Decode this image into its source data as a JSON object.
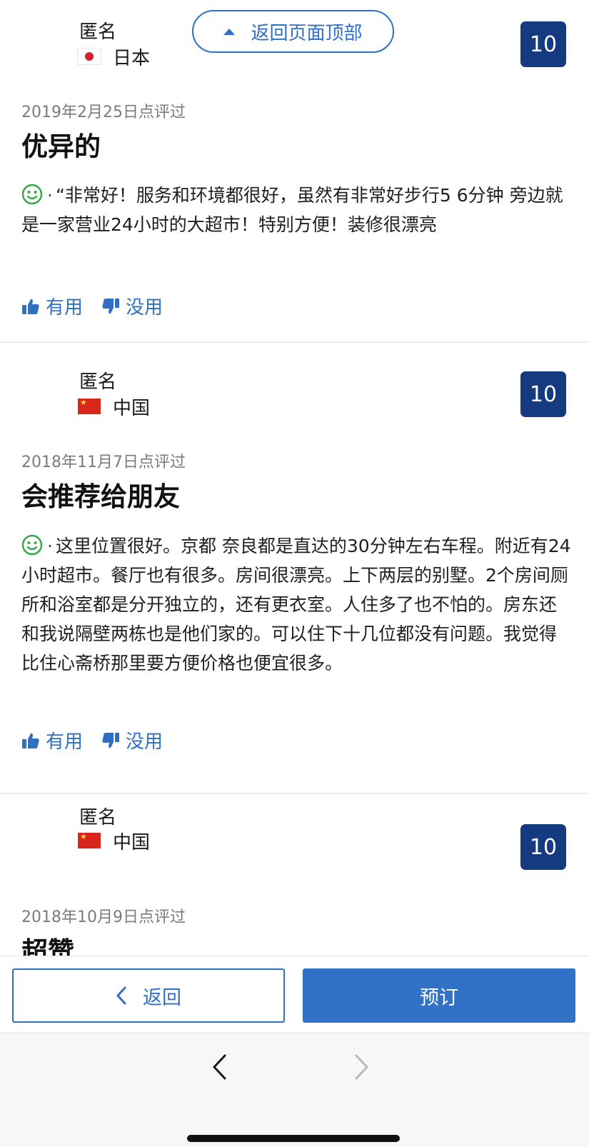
{
  "back_to_top_label": "返回页面顶部",
  "vote_labels": {
    "helpful": "有用",
    "not_helpful": "没用"
  },
  "reviews": [
    {
      "name": "匿名",
      "country": "日本",
      "flag": "jp",
      "score": "10",
      "date": "2019年2月25日点评过",
      "title": "优异的",
      "body": "“非常好！服务和环境都很好，虽然有非常好步行5 6分钟 旁边就是一家营业24小时的大超市！特别方便！装修很漂亮"
    },
    {
      "name": "匿名",
      "country": "中国",
      "flag": "cn",
      "score": "10",
      "date": "2018年11月7日点评过",
      "title": "会推荐给朋友",
      "body": "这里位置很好。京都 奈良都是直达的30分钟左右车程。附近有24小时超市。餐厅也有很多。房间很漂亮。上下两层的别墅。2个房间厕所和浴室都是分开独立的，还有更衣室。人住多了也不怕的。房东还和我说隔壁两栋也是他们家的。可以住下十几位都没有问题。我觉得比住心斋桥那里要方便价格也便宜很多。"
    },
    {
      "name": "匿名",
      "country": "中国",
      "flag": "cn",
      "score": "10",
      "date": "2018年10月9日点评过",
      "title": "超赞"
    }
  ],
  "action_bar": {
    "back_label": "返回",
    "book_label": "预订"
  },
  "colors": {
    "accent": "#2f6fc4",
    "score_bg": "#163a7f",
    "positive": "#3aa84a"
  },
  "icons": {
    "thumbs_up": "thumbs-up-icon",
    "thumbs_down": "thumbs-down-icon",
    "smile": "smiley-face-icon",
    "back_chevron": "chevron-left-icon",
    "caret_up": "caret-up-icon"
  }
}
